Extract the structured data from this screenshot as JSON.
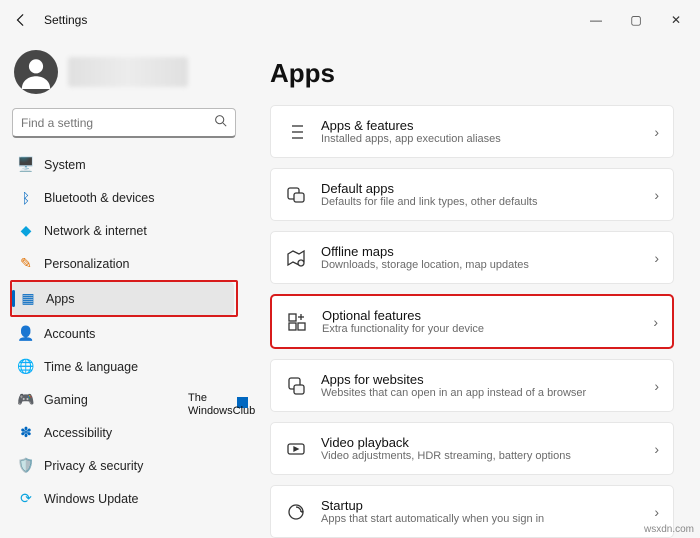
{
  "titlebar": {
    "title": "Settings"
  },
  "search": {
    "placeholder": "Find a setting"
  },
  "nav": [
    {
      "label": "System",
      "icon": "🖥️",
      "color": ""
    },
    {
      "label": "Bluetooth & devices",
      "icon": "ᛒ",
      "color": "#0067c0"
    },
    {
      "label": "Network & internet",
      "icon": "◆",
      "color": "#0aa3de"
    },
    {
      "label": "Personalization",
      "icon": "✎",
      "color": "#e07000"
    },
    {
      "label": "Apps",
      "icon": "▦",
      "color": "#0067c0"
    },
    {
      "label": "Accounts",
      "icon": "👤",
      "color": "#d07a7a"
    },
    {
      "label": "Time & language",
      "icon": "🌐",
      "color": "#008aa0"
    },
    {
      "label": "Gaming",
      "icon": "🎮",
      "color": "#555"
    },
    {
      "label": "Accessibility",
      "icon": "✽",
      "color": "#0067c0"
    },
    {
      "label": "Privacy & security",
      "icon": "🛡️",
      "color": "#555"
    },
    {
      "label": "Windows Update",
      "icon": "⟳",
      "color": "#0aa3de"
    }
  ],
  "main": {
    "heading": "Apps",
    "cards": [
      {
        "title": "Apps & features",
        "sub": "Installed apps, app execution aliases"
      },
      {
        "title": "Default apps",
        "sub": "Defaults for file and link types, other defaults"
      },
      {
        "title": "Offline maps",
        "sub": "Downloads, storage location, map updates"
      },
      {
        "title": "Optional features",
        "sub": "Extra functionality for your device"
      },
      {
        "title": "Apps for websites",
        "sub": "Websites that can open in an app instead of a browser"
      },
      {
        "title": "Video playback",
        "sub": "Video adjustments, HDR streaming, battery options"
      },
      {
        "title": "Startup",
        "sub": "Apps that start automatically when you sign in"
      }
    ]
  },
  "watermark": {
    "line1": "The",
    "line2": "WindowsClub"
  },
  "footer": "wsxdn.com"
}
